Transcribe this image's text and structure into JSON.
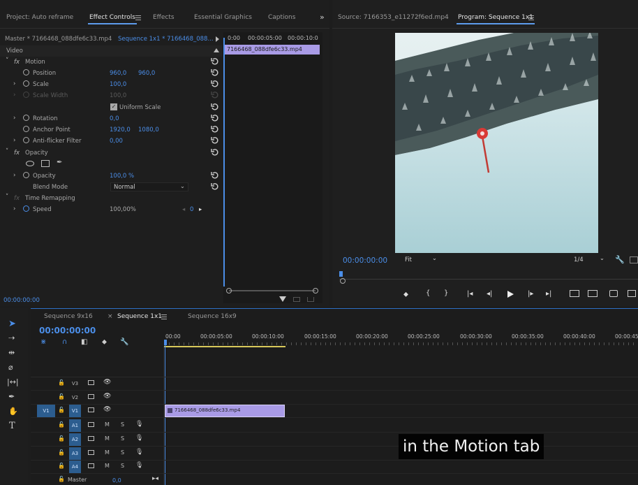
{
  "effect_panel": {
    "tabs": [
      {
        "label": "Project: Auto reframe"
      },
      {
        "label": "Effect Controls"
      },
      {
        "label": "Effects"
      },
      {
        "label": "Essential Graphics"
      },
      {
        "label": "Captions"
      }
    ],
    "master_label": "Master * 7166468_088dfe6c33.mp4",
    "sequence_label": "Sequence 1x1 * 7166468_088...",
    "ruler": [
      "0:00",
      "00:00:05:00",
      "00:00:10:0"
    ],
    "clip_name": "7166468_088dfe6c33.mp4",
    "video_label": "Video",
    "motion_label": "Motion",
    "position_label": "Position",
    "position_x": "960,0",
    "position_y": "960,0",
    "scale_label": "Scale",
    "scale_value": "100,0",
    "scale_width_label": "Scale Width",
    "scale_width_value": "100,0",
    "uniform_scale_label": "Uniform Scale",
    "rotation_label": "Rotation",
    "rotation_value": "0,0",
    "anchor_label": "Anchor Point",
    "anchor_x": "1920,0",
    "anchor_y": "1080,0",
    "antiflicker_label": "Anti-flicker Filter",
    "antiflicker_value": "0,00",
    "opacity_group_label": "Opacity",
    "opacity_label": "Opacity",
    "opacity_value": "100,0 %",
    "blend_label": "Blend Mode",
    "blend_value": "Normal",
    "time_remap_label": "Time Remapping",
    "speed_label": "Speed",
    "speed_value": "100,00%",
    "speed_keyframe": "0",
    "timecode": "00:00:00:00"
  },
  "source_panel": {
    "source_tab": "Source: 7166353_e11272f6ed.mp4",
    "program_tab": "Program: Sequence 1x1",
    "timecode": "00:00:00:00",
    "fit_value": "Fit",
    "res_value": "1/4"
  },
  "timeline": {
    "tabs": [
      {
        "label": "Sequence 9x16"
      },
      {
        "label": "Sequence 1x1"
      },
      {
        "label": "Sequence 16x9"
      }
    ],
    "timecode": "00:00:00:00",
    "ruler": [
      "00:00",
      "00:00:05:00",
      "00:00:10:00",
      "00:00:15:00",
      "00:00:20:00",
      "00:00:25:00",
      "00:00:30:00",
      "00:00:35:00",
      "00:00:40:00",
      "00:00:45"
    ],
    "video_tracks": [
      "V3",
      "V2",
      "V1"
    ],
    "audio_tracks": [
      "A1",
      "A2",
      "A3",
      "A4"
    ],
    "source_patch": "V1",
    "mute_label": "M",
    "solo_label": "S",
    "master_label": "Master",
    "master_value": "0,0",
    "clip_name": "7166468_088dfe6c33.mp4"
  },
  "caption": "in the Motion tab",
  "colors": {
    "accent_blue": "#4b8ee8",
    "clip_purple": "#a99be6",
    "panel_bg": "#1d1d1d"
  }
}
